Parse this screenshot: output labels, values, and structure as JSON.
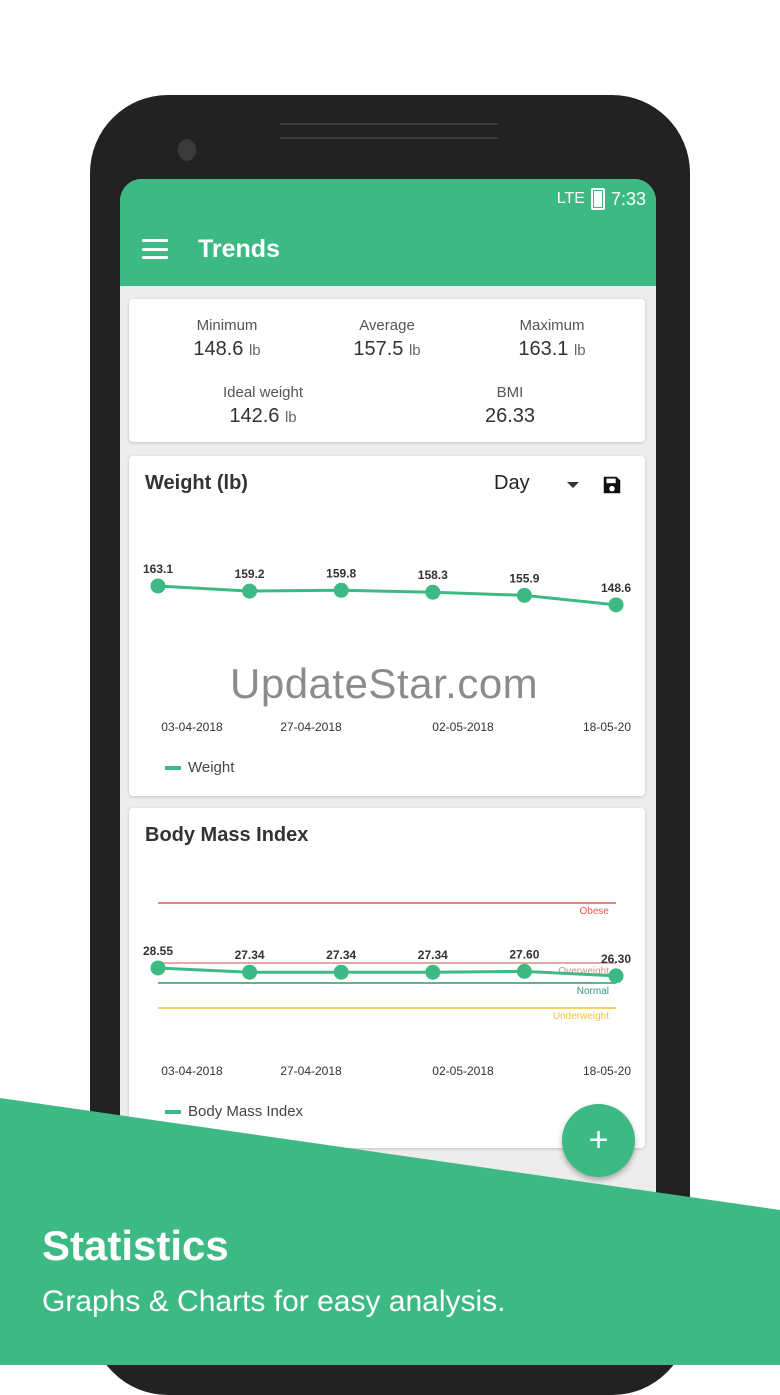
{
  "status_bar": {
    "network": "LTE",
    "time": "7:33"
  },
  "app_bar": {
    "title": "Trends"
  },
  "stats": {
    "minimum": {
      "label": "Minimum",
      "value": "148.6",
      "unit": "lb"
    },
    "average": {
      "label": "Average",
      "value": "157.5",
      "unit": "lb"
    },
    "maximum": {
      "label": "Maximum",
      "value": "163.1",
      "unit": "lb"
    },
    "ideal": {
      "label": "Ideal weight",
      "value": "142.6",
      "unit": "lb"
    },
    "bmi": {
      "label": "BMI",
      "value": "26.33"
    }
  },
  "weight_card": {
    "title": "Weight (lb)",
    "period": "Day",
    "legend": "Weight"
  },
  "bmi_card": {
    "title": "Body Mass Index",
    "legend": "Body Mass Index"
  },
  "chart_data": [
    {
      "type": "line",
      "title": "Weight (lb)",
      "x_ticks": [
        "03-04-2018",
        "27-04-2018",
        "02-05-2018",
        "18-05-20"
      ],
      "series": [
        {
          "name": "Weight",
          "values": [
            163.1,
            159.2,
            159.8,
            158.3,
            155.9,
            148.6
          ]
        }
      ],
      "point_labels": [
        "163.1",
        "159.2",
        "159.8",
        "158.3",
        "155.9",
        "148.6"
      ],
      "color": "#3dba83"
    },
    {
      "type": "line",
      "title": "Body Mass Index",
      "x_ticks": [
        "03-04-2018",
        "27-04-2018",
        "02-05-2018",
        "18-05-20"
      ],
      "series": [
        {
          "name": "Body Mass Index",
          "values": [
            28.55,
            27.34,
            27.34,
            27.34,
            27.6,
            26.3
          ]
        }
      ],
      "point_labels": [
        "28.55",
        "27.34",
        "27.34",
        "27.34",
        "27.60",
        "26.30"
      ],
      "reference_lines": [
        {
          "label": "Obese",
          "value": 30,
          "color": "#e05a5a"
        },
        {
          "label": "Overweight",
          "value": 25,
          "color": "#e08a8a"
        },
        {
          "label": "Normal",
          "value": 18.5,
          "color": "#2a9a6a"
        },
        {
          "label": "Underweight",
          "value": 16,
          "color": "#f0c23a"
        }
      ],
      "color": "#3dba83"
    }
  ],
  "fab": {
    "label": "+"
  },
  "promo": {
    "title": "Statistics",
    "subtitle": "Graphs & Charts for easy analysis."
  },
  "watermark": "UpdateStar.com",
  "colors": {
    "accent": "#3dba83",
    "banner": "#3dba83"
  }
}
